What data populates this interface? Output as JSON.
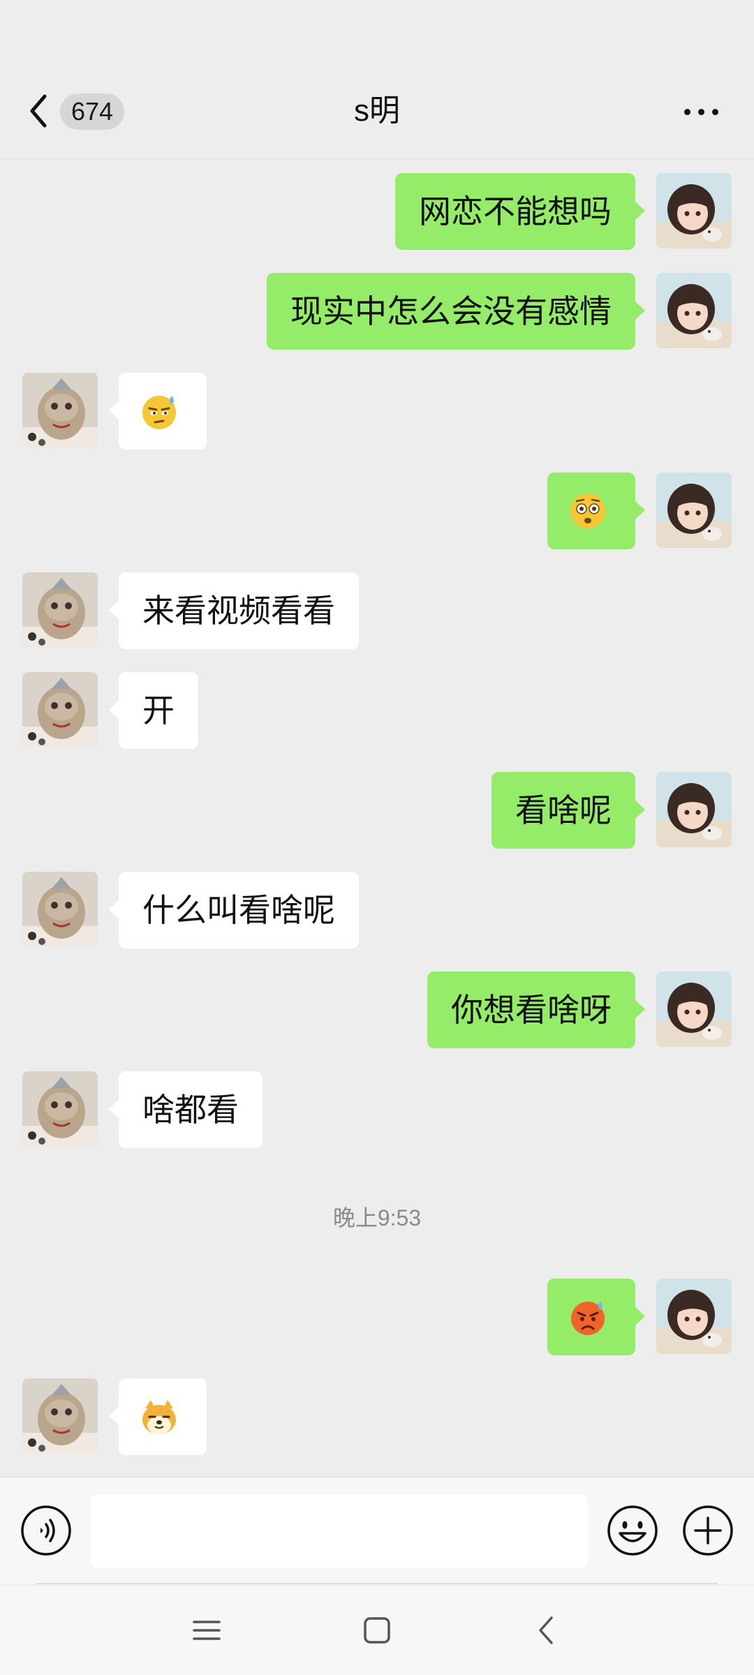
{
  "header": {
    "unread_count": "674",
    "title": "s明"
  },
  "messages": [
    {
      "side": "out",
      "type": "text",
      "text": "网恋不能想吗"
    },
    {
      "side": "out",
      "type": "text",
      "text": "现实中怎么会没有感情"
    },
    {
      "side": "in",
      "type": "emoji",
      "emoji": "smirk-sweat-emoji"
    },
    {
      "side": "out",
      "type": "emoji",
      "emoji": "flushed-emoji"
    },
    {
      "side": "in",
      "type": "text",
      "text": "来看视频看看"
    },
    {
      "side": "in",
      "type": "text",
      "text": "开"
    },
    {
      "side": "out",
      "type": "text",
      "text": "看啥呢"
    },
    {
      "side": "in",
      "type": "text",
      "text": "什么叫看啥呢"
    },
    {
      "side": "out",
      "type": "text",
      "text": "你想看啥呀"
    },
    {
      "side": "in",
      "type": "text",
      "text": "啥都看"
    },
    {
      "side": "out",
      "type": "emoji",
      "emoji": "angry-sweat-emoji"
    },
    {
      "side": "in",
      "type": "emoji",
      "emoji": "doge-emoji"
    }
  ],
  "timestamp": "晚上9:53",
  "input": {
    "value": "",
    "placeholder": ""
  },
  "colors": {
    "outgoing_bubble": "#95ec69",
    "incoming_bubble": "#ffffff",
    "background": "#ededed"
  }
}
